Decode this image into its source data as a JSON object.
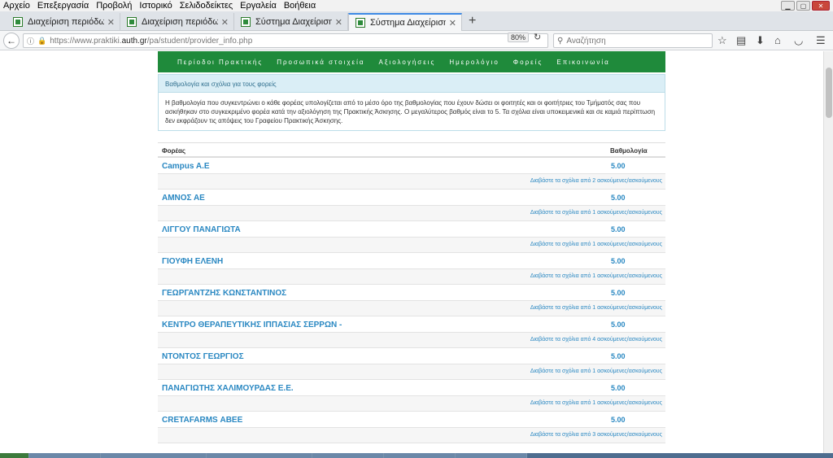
{
  "menubar": {
    "items": [
      "Αρχείο",
      "Επεξεργασία",
      "Προβολή",
      "Ιστορικό",
      "Σελιδοδείκτες",
      "Εργαλεία",
      "Βοήθεια"
    ]
  },
  "tabs": [
    {
      "label": "Διαχείριση περιόδων"
    },
    {
      "label": "Διαχείριση περιόδων"
    },
    {
      "label": "Σύστημα Διαχείρισης Πρα..."
    },
    {
      "label": "Σύστημα Διαχείρισης Πρα..."
    }
  ],
  "navbar": {
    "url_prefix": "https://www.praktiki.",
    "url_domain": "auth.gr",
    "url_path": "/pa/student/provider_info.php",
    "zoom": "80%",
    "search_placeholder": "Αναζήτηση"
  },
  "site_nav": [
    "Περίοδοι Πρακτικής",
    "Προσωπικά στοιχεία",
    "Αξιολογήσεις",
    "Ημερολόγιο",
    "Φορείς",
    "Επικοινωνία"
  ],
  "info": {
    "heading": "Βαθμολογία και σχόλια για τους φορείς",
    "text": "Η βαθμολογία που συγκεντρώνει ο κάθε φορέας υπολογίζεται από το μέσο όρο της βαθμολογίας που έχουν δώσει οι φοιτητές και οι φοιτήτριες του Τμήματός σας που ασκήθηκαν στο συγκεκριμένο φορέα κατά την αξιολόγηση της Πρακτικής Άσκησης. Ο μεγαλύτερος βαθμός είναι το 5. Τα σχόλια είναι υποκειμενικά και σε καμιά περίπτωση δεν εκφράζουν τις απόψεις του Γραφείου Πρακτικής Άσκησης."
  },
  "table": {
    "col_provider": "Φορέας",
    "col_score": "Βαθμολογία",
    "rows": [
      {
        "name": "Campus A.E",
        "score": "5.00",
        "comments": "Διαβάστε τα σχόλια από 2 ασκούμενες/ασκούμενους"
      },
      {
        "name": "ΑΜΝΟΣ ΑΕ",
        "score": "5.00",
        "comments": "Διαβάστε τα σχόλια από 1 ασκούμενες/ασκούμενους"
      },
      {
        "name": "ΛΙΓΓΟΥ ΠΑΝΑΓΙΩΤΑ",
        "score": "5.00",
        "comments": "Διαβάστε τα σχόλια από 1 ασκούμενες/ασκούμενους"
      },
      {
        "name": "ΓΙΟΥΦΗ ΕΛΕΝΗ",
        "score": "5.00",
        "comments": "Διαβάστε τα σχόλια από 1 ασκούμενες/ασκούμενους"
      },
      {
        "name": "ΓΕΩΡΓΑΝΤΖΗΣ ΚΩΝΣΤΑΝΤΙΝΟΣ",
        "score": "5.00",
        "comments": "Διαβάστε τα σχόλια από 1 ασκούμενες/ασκούμενους"
      },
      {
        "name": "ΚΕΝΤΡΟ ΘΕΡΑΠΕΥΤΙΚΗΣ ΙΠΠΑΣΙΑΣ ΣΕΡΡΩΝ -",
        "score": "5.00",
        "comments": "Διαβάστε τα σχόλια από 4 ασκούμενες/ασκούμενους"
      },
      {
        "name": "ΝΤΟΝΤΟΣ ΓΕΩΡΓΙΟΣ",
        "score": "5.00",
        "comments": "Διαβάστε τα σχόλια από 1 ασκούμενες/ασκούμενους"
      },
      {
        "name": "ΠΑΝΑΓΙΩΤΗΣ ΧΑΛΙΜΟΥΡΔΑΣ Ε.Ε.",
        "score": "5.00",
        "comments": "Διαβάστε τα σχόλια από 1 ασκούμενες/ασκούμενους"
      },
      {
        "name": "CRETAFARMS ΑΒΕΕ",
        "score": "5.00",
        "comments": "Διαβάστε τα σχόλια από 3 ασκούμενες/ασκούμενους"
      }
    ]
  },
  "colors": {
    "nav_green": "#1f8a3b",
    "link_blue": "#2a88c2",
    "info_bg": "#daeef6"
  },
  "icons": [
    "back-arrow-icon",
    "info-icon",
    "lock-icon",
    "reload-icon",
    "search-icon",
    "bookmark-star-icon",
    "reading-list-icon",
    "download-icon",
    "home-icon",
    "pocket-icon",
    "menu-icon"
  ]
}
